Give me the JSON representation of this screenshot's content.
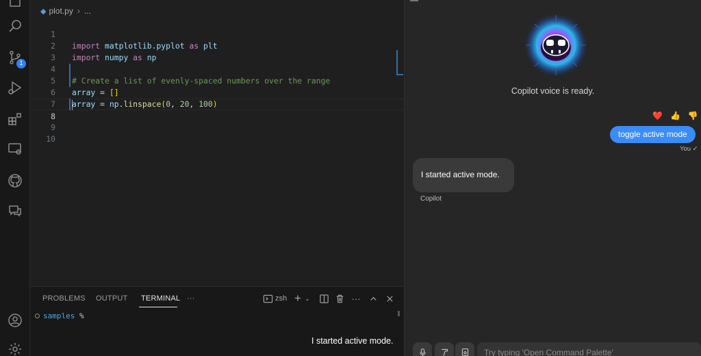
{
  "activity_bar": {
    "icons": [
      "files-icon",
      "search-icon",
      "source-control-icon",
      "run-debug-icon",
      "extensions-icon",
      "remote-explorer-icon",
      "github-icon",
      "chat-icon",
      "account-icon",
      "settings-gear-icon"
    ],
    "source_control_badge": "1"
  },
  "editor": {
    "breadcrumb": {
      "file": "plot.py",
      "rest": "..."
    },
    "lines": [
      {
        "n": "1"
      },
      {
        "n": "2"
      },
      {
        "n": "3"
      },
      {
        "n": "4"
      },
      {
        "n": "5"
      },
      {
        "n": "6"
      },
      {
        "n": "7"
      },
      {
        "n": "8"
      },
      {
        "n": "9"
      },
      {
        "n": "10"
      }
    ],
    "code": {
      "l1_kw": "import",
      "l1_mod": "matplotlib.pyplot",
      "l1_as": "as",
      "l1_alias": "plt",
      "l2_kw": "import",
      "l2_mod": "numpy",
      "l2_as": "as",
      "l2_alias": "np",
      "l4_comment": "# Create a list of evenly-spaced numbers over the range",
      "l5_var": "array",
      "l5_op": " = ",
      "l5_val": "[]",
      "l6_var": "array",
      "l6_op": " = ",
      "l6_obj": "np",
      "l6_dot": ".",
      "l6_fn": "linspace",
      "l6_open": "(",
      "l6_a": "0",
      "l6_c1": ", ",
      "l6_b": "20",
      "l6_c2": ", ",
      "l6_c": "100",
      "l6_close": ")"
    }
  },
  "panel": {
    "tabs": [
      "PROBLEMS",
      "OUTPUT",
      "TERMINAL",
      "···"
    ],
    "active_tab": "TERMINAL",
    "shell": "zsh",
    "terminal": {
      "path": "samples",
      "prompt": "%"
    },
    "caption": "I started active mode."
  },
  "chat": {
    "voice_ready": "Copilot voice is ready.",
    "reactions": [
      "❤️",
      "👍",
      "👎"
    ],
    "user_message": "toggle active mode",
    "user_label": "You ✓",
    "bot_message": "I started active mode.",
    "bot_label": "Copilot",
    "input_placeholder": "Try typing 'Open Command Palette'"
  },
  "colors": {
    "accent": "#3b8cf6",
    "editor_bg": "#1f1f1f",
    "chat_bg": "#262626"
  }
}
